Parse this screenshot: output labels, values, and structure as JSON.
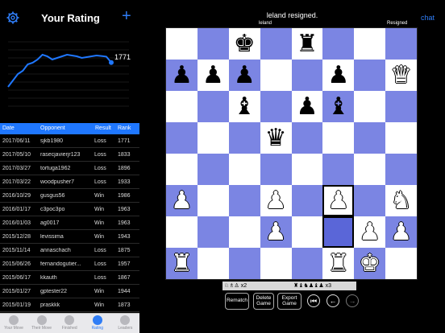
{
  "header": {
    "title": "Your Rating",
    "settings_icon": "gear-icon",
    "add_icon": "plus-icon"
  },
  "rating": {
    "current": "1771",
    "points": [
      1620,
      1660,
      1700,
      1720,
      1760,
      1770,
      1790,
      1820,
      1810,
      1790,
      1800,
      1810,
      1820,
      1815,
      1810,
      1800,
      1805,
      1810,
      1815,
      1812,
      1808,
      1771
    ]
  },
  "table": {
    "headers": {
      "date": "Date",
      "opponent": "Opponent",
      "result": "Result",
      "rank": "Rank"
    },
    "rows": [
      {
        "date": "2017/06/11",
        "opponent": "sjkb1980",
        "result": "Loss",
        "rank": "1771"
      },
      {
        "date": "2017/05/10",
        "opponent": "rasecjavierjr123",
        "result": "Loss",
        "rank": "1833"
      },
      {
        "date": "2017/03/27",
        "opponent": "tortuga1962",
        "result": "Loss",
        "rank": "1896"
      },
      {
        "date": "2017/03/22",
        "opponent": "woodpusher7",
        "result": "Loss",
        "rank": "1933"
      },
      {
        "date": "2016/10/29",
        "opponent": "gusgus56",
        "result": "Win",
        "rank": "1986"
      },
      {
        "date": "2016/01/17",
        "opponent": "c3poc3po",
        "result": "Win",
        "rank": "1963"
      },
      {
        "date": "2016/01/03",
        "opponent": "ag0017",
        "result": "Win",
        "rank": "1963"
      },
      {
        "date": "2015/12/28",
        "opponent": "levissima",
        "result": "Win",
        "rank": "1943"
      },
      {
        "date": "2015/11/14",
        "opponent": "annaschach",
        "result": "Loss",
        "rank": "1875"
      },
      {
        "date": "2015/06/26",
        "opponent": "fernandogutier...",
        "result": "Loss",
        "rank": "1957"
      },
      {
        "date": "2015/06/17",
        "opponent": "kkauth",
        "result": "Loss",
        "rank": "1867"
      },
      {
        "date": "2015/01/27",
        "opponent": "gptester22",
        "result": "Win",
        "rank": "1944"
      },
      {
        "date": "2015/01/19",
        "opponent": "praskkk",
        "result": "Win",
        "rank": "1873"
      },
      {
        "date": "2015/01/18",
        "opponent": "rajesh16",
        "result": "Loss",
        "rank": "1814"
      }
    ]
  },
  "tabs": [
    {
      "label": "Your Move",
      "active": false
    },
    {
      "label": "Their Move",
      "active": false
    },
    {
      "label": "Finished",
      "active": false
    },
    {
      "label": "Rating",
      "active": true
    },
    {
      "label": "Leaders",
      "active": false
    }
  ],
  "game": {
    "status": "leland resigned.",
    "chat_label": "chat",
    "top_player": "leland",
    "resigned_label": "Resigned",
    "captured_white": "x2",
    "captured_black": "x3"
  },
  "board": {
    "ranks": [
      [
        null,
        null,
        "bK",
        null,
        "bR",
        null,
        null,
        null
      ],
      [
        "bP",
        "bP",
        "bP",
        null,
        null,
        "bP",
        null,
        "wQ"
      ],
      [
        null,
        null,
        "bB",
        null,
        "bP",
        "bB",
        null,
        null
      ],
      [
        null,
        null,
        null,
        "bQ",
        null,
        null,
        null,
        null
      ],
      [
        null,
        null,
        null,
        null,
        null,
        null,
        null,
        null
      ],
      [
        "wP",
        null,
        null,
        "wP",
        null,
        "wP",
        null,
        "wN"
      ],
      [
        null,
        null,
        null,
        "wP",
        null,
        null,
        "wP",
        "wP"
      ],
      [
        "wR",
        null,
        null,
        null,
        null,
        "wR",
        "wK",
        null
      ]
    ],
    "selected": [
      5,
      5
    ],
    "target": [
      6,
      5
    ]
  },
  "controls": {
    "rematch": "Rematch",
    "delete": "Delete Game",
    "export": "Export Game"
  },
  "colors": {
    "accent": "#2f7df6",
    "dark_square": "#7b85e3",
    "light_square": "#ffffff"
  }
}
